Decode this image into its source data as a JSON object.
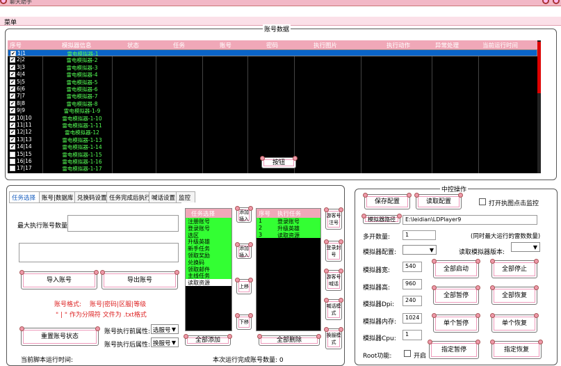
{
  "window": {
    "title": "聊天助手"
  },
  "menu": {
    "label": "菜单"
  },
  "accounts": {
    "group_title": "账号数据",
    "columns": [
      "序号",
      "模拟器信息",
      "状态",
      "任务",
      "账号",
      "密码",
      "执行图片",
      "执行动作",
      "异常处理",
      "当前运行时间"
    ],
    "rows": [
      {
        "no": "1|1",
        "name": "雷电模拟器-1",
        "checked": true
      },
      {
        "no": "2|2",
        "name": "雷电模拟器-2",
        "checked": true
      },
      {
        "no": "3|3",
        "name": "雷电模拟器-3",
        "checked": true
      },
      {
        "no": "4|4",
        "name": "雷电模拟器-4",
        "checked": true
      },
      {
        "no": "5|5",
        "name": "雷电模拟器-5",
        "checked": true
      },
      {
        "no": "6|6",
        "name": "雷电模拟器-6",
        "checked": true
      },
      {
        "no": "7|7",
        "name": "雷电模拟器-7",
        "checked": true
      },
      {
        "no": "8|8",
        "name": "雷电模拟器-8",
        "checked": true
      },
      {
        "no": "9|9",
        "name": "雷电模拟器-1-9",
        "checked": true
      },
      {
        "no": "10|10",
        "name": "雷电模拟器-1-10",
        "checked": true
      },
      {
        "no": "11|11",
        "name": "雷电模拟器-1-11",
        "checked": true
      },
      {
        "no": "12|12",
        "name": "雷电模拟器-12",
        "checked": true
      },
      {
        "no": "13|13",
        "name": "雷电模拟器-1-13",
        "checked": true
      },
      {
        "no": "14|14",
        "name": "雷电模拟器-1-14",
        "checked": true
      },
      {
        "no": "15|15",
        "name": "雷电模拟器-1-15",
        "checked": false
      },
      {
        "no": "16|16",
        "name": "雷电模拟器-1-16",
        "checked": false
      },
      {
        "no": "17|17",
        "name": "雷电模拟器-1-17",
        "checked": false
      }
    ],
    "float_button": "按钮"
  },
  "tabs": [
    "任务选择",
    "账号|数据库",
    "兑换码设置",
    "任务完成后执行",
    "喊话设置",
    "监控"
  ],
  "task": {
    "max_accounts_label": "最大执行账号数量:",
    "import_button": "导入账号",
    "export_button": "导出账号",
    "format_label": "账号格式:",
    "format_value": "账号|密码|区服|等级",
    "format_hint": "\" | \" 作为分隔符  文件为 .txt格式",
    "reset_button": "重置账号状态",
    "before_label": "账号执行前属性:",
    "before_value": "选服号",
    "after_label": "账号执行后属性:",
    "after_value": "换服号",
    "runtime_label": "当前脚本运行时间:",
    "done_label": "本次运行完成账号数量: 0"
  },
  "task_list": {
    "header": "任务选择",
    "items": [
      {
        "label": "注册账号",
        "style": "g"
      },
      {
        "label": "登录账号",
        "style": "g"
      },
      {
        "label": "选区",
        "style": "g"
      },
      {
        "label": "升级英雄",
        "style": "g"
      },
      {
        "label": "新手任务",
        "style": "g"
      },
      {
        "label": "领取奖励",
        "style": "g"
      },
      {
        "label": "兑换码",
        "style": "g"
      },
      {
        "label": "领取邮件",
        "style": "g"
      },
      {
        "label": "主线任务",
        "style": "g"
      },
      {
        "label": "读取资源",
        "style": "w"
      }
    ],
    "add_all": "全部添加"
  },
  "mid_buttons": [
    "添加插入",
    "添加插入",
    "上移",
    "下移"
  ],
  "exec_list": {
    "h_no": "序号",
    "h_task": "执行任务",
    "items": [
      {
        "no": "1",
        "task": "登录账号"
      },
      {
        "no": "2",
        "task": "升级英雄"
      },
      {
        "no": "3",
        "task": "读取资源"
      }
    ],
    "remove_all": "全部删除"
  },
  "right_side_buttons": [
    "游客号注号",
    "登录封号",
    "游客号喊话",
    "喊话模式",
    "换服模式"
  ],
  "middle": {
    "group_title": "中控操作",
    "save_button": "保存配置",
    "load_button": "读取配置",
    "monitor_label": "打开执图点击监控",
    "path_button": "模拟器路径",
    "path_value": "E:\\leidian\\LDPlayer9",
    "multi_label": "多开数量:",
    "multi_value": "1",
    "multi_hint": "(同时最大运行的雷数数量)",
    "config_label": "模拟器配置:",
    "read_version_label": "读取模拟器版本:",
    "width_label": "模拟器宽:",
    "width_value": "540",
    "height_label": "模拟器高:",
    "height_value": "960",
    "dpi_label": "模拟器Dpi:",
    "dpi_value": "240",
    "mem_label": "模拟器内存:",
    "mem_value": "1024",
    "cpu_label": "模拟器Cpu:",
    "cpu_value": "1",
    "root_label": "Root功能:",
    "root_check_label": "开启",
    "start_all": "全部启动",
    "stop_all": "全部停止",
    "pause_all": "全部暂停",
    "resume_all": "全部恢复",
    "pause_one": "单个暂停",
    "resume_one": "单个恢复",
    "pause_spec": "指定暂停",
    "resume_spec": "指定恢复"
  }
}
